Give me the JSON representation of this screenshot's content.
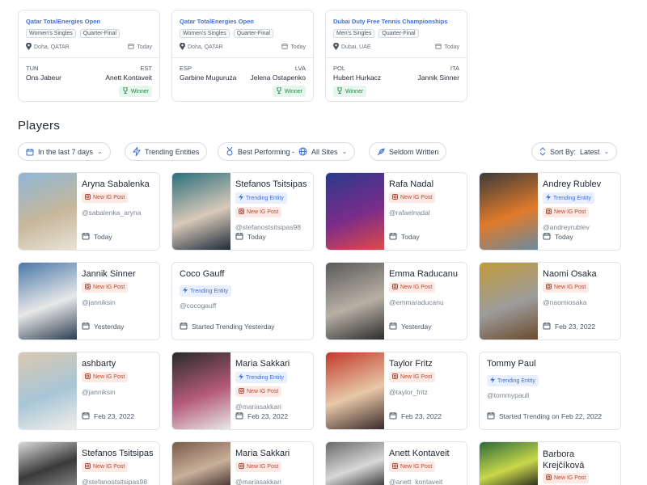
{
  "matches": [
    {
      "tournament": "Qatar TotalEnergies Open",
      "tags": [
        "Women's Singles",
        "Quarter-Final"
      ],
      "location": "Doha, QATAR",
      "date": "Today",
      "country1": "TUN",
      "player1": "Ons Jabeur",
      "country2": "EST",
      "player2": "Anett Kontaveit",
      "winner_label": "Winner",
      "winner_side": "right"
    },
    {
      "tournament": "Qatar TotalEnergies Open",
      "tags": [
        "Women's Singles",
        "Quarter-Final"
      ],
      "location": "Doha, QATAR",
      "date": "Today",
      "country1": "ESP",
      "player1": "Garbine Muguruza",
      "country2": "LVA",
      "player2": "Jelena Ostapenko",
      "winner_label": "Winner",
      "winner_side": "right"
    },
    {
      "tournament": "Dubai Duty Free Tennis Championships",
      "tags": [
        "Men's Singles",
        "Quarter-Final"
      ],
      "location": "Dubai, UAE",
      "date": "Today",
      "country1": "POL",
      "player1": "Hubert Hurkacz",
      "country2": "ITA",
      "player2": "Jannik Sinner",
      "winner_label": "Winner",
      "winner_side": "left"
    }
  ],
  "players_section": {
    "title": "Players"
  },
  "filters": {
    "date_range": "In the last 7 days",
    "trending": "Trending Entities",
    "best_performing": "Best Performing -",
    "sites": "All Sites",
    "seldom": "Seldom Written",
    "sort_label": "Sort By:",
    "sort_value": "Latest"
  },
  "players": [
    {
      "name": "Aryna Sabalenka",
      "badges": [
        "New IG Post"
      ],
      "handle": "@sabalenka_aryna",
      "date": "Today",
      "photo_colors": [
        "#8fb7d6",
        "#c7b79b",
        "#e9e3d6"
      ]
    },
    {
      "name": "Stefanos Tsitsipas",
      "badges": [
        "Trending Entity",
        "New IG Post"
      ],
      "handle": "@stefanostsitsipas98",
      "date": "Today",
      "photo_colors": [
        "#2a6f7d",
        "#d9c9b8",
        "#1d2b3a"
      ]
    },
    {
      "name": "Rafa Nadal",
      "badges": [
        "New IG Post"
      ],
      "handle": "@rafaelnadal",
      "date": "Today",
      "photo_colors": [
        "#2b3a8c",
        "#7a2c8a",
        "#e04a4a"
      ]
    },
    {
      "name": "Andrey Rublev",
      "badges": [
        "Trending Entity",
        "New IG Post"
      ],
      "handle": "@andreyrublev",
      "date": "Today",
      "photo_colors": [
        "#3b3b3b",
        "#e07a2a",
        "#6a8aa0"
      ]
    },
    {
      "name": "Jannik Sinner",
      "badges": [
        "New IG Post"
      ],
      "handle": "@janniksin",
      "date": "Yesterday",
      "photo_colors": [
        "#4a78a8",
        "#e8e8e8",
        "#2c3e50"
      ]
    },
    {
      "name": "Coco Gauff",
      "badges": [
        "Trending Entity"
      ],
      "handle": "@cocogauff",
      "date": "Started Trending Yesterday",
      "photo_colors": []
    },
    {
      "name": "Emma Raducanu",
      "badges": [
        "New IG Post"
      ],
      "handle": "@emmaraducanu",
      "date": "Yesterday",
      "photo_colors": [
        "#5a5a5a",
        "#b7b0a4",
        "#2d2d2d"
      ]
    },
    {
      "name": "Naomi Osaka",
      "badges": [
        "New IG Post"
      ],
      "handle": "@naomiosaka",
      "date": "Feb 23, 2022",
      "photo_colors": [
        "#c29a3a",
        "#9c9c9c",
        "#6b4a2a"
      ]
    },
    {
      "name": "ashbarty",
      "badges": [
        "New IG Post"
      ],
      "handle": "@janniksin",
      "date": "Feb 23, 2022",
      "photo_colors": [
        "#d9c8b0",
        "#a8c6d8",
        "#f2efe8"
      ]
    },
    {
      "name": "Maria Sakkari",
      "badges": [
        "Trending Entity",
        "New IG Post"
      ],
      "handle": "@mariasakkari",
      "date": "Feb 23, 2022",
      "photo_colors": [
        "#2a2a2a",
        "#b55a7a",
        "#e7e7e7"
      ]
    },
    {
      "name": "Taylor Fritz",
      "badges": [
        "New IG Post"
      ],
      "handle": "@taylor_fritz",
      "date": "Feb 23, 2022",
      "photo_colors": [
        "#c23a2a",
        "#e8c8a8",
        "#3a2a2a"
      ]
    },
    {
      "name": "Tommy Paul",
      "badges": [
        "Trending Entity"
      ],
      "handle": "@tommypaull",
      "date": "Started Trending on Feb 22, 2022",
      "photo_colors": []
    },
    {
      "name": "Stefanos Tsitsipas",
      "badges": [
        "New IG Post"
      ],
      "handle": "@stefanostsitsipas98",
      "date": "",
      "photo_colors": [
        "#d9d9d9",
        "#3a3a3a",
        "#8a8a8a"
      ]
    },
    {
      "name": "Maria Sakkari",
      "badges": [
        "New IG Post"
      ],
      "handle": "@mariasakkari",
      "date": "",
      "photo_colors": [
        "#7a5a4a",
        "#c9b09a",
        "#3a2a2a"
      ]
    },
    {
      "name": "Anett Kontaveit",
      "badges": [
        "New IG Post"
      ],
      "handle": "@anett_kontaveit",
      "date": "",
      "photo_colors": [
        "#6a6a6a",
        "#d8d8d8",
        "#2a2a2a"
      ]
    },
    {
      "name": "Barbora Krejčíková",
      "badges": [
        "New IG Post"
      ],
      "handle": "",
      "date": "",
      "photo_colors": [
        "#2e6a3a",
        "#c8d84a",
        "#1a1a1a"
      ]
    }
  ],
  "colors": {
    "accent": "#3f6ed8",
    "ig_badge": "#c0462b",
    "trend_badge": "#3f6ed8",
    "winner": "#1f8a4c"
  }
}
